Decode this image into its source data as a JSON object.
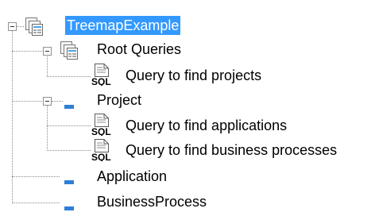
{
  "tree": {
    "nodes": [
      {
        "label": "TreemapExample",
        "icon": "folder-stack-icon",
        "expanded": true,
        "selected": true
      },
      {
        "label": "Root Queries",
        "icon": "folder-stack-icon",
        "expanded": true,
        "selected": false
      },
      {
        "label": "Query to find projects",
        "icon": "sql-query-icon",
        "selected": false
      },
      {
        "label": "Project",
        "icon": "entity-dash-icon",
        "expanded": true,
        "selected": false
      },
      {
        "label": "Query to find applications",
        "icon": "sql-query-icon",
        "selected": false
      },
      {
        "label": "Query to find business processes",
        "icon": "sql-query-icon",
        "selected": false
      },
      {
        "label": "Application",
        "icon": "entity-dash-icon",
        "selected": false
      },
      {
        "label": "BusinessProcess",
        "icon": "entity-dash-icon",
        "selected": false
      }
    ],
    "colors": {
      "selection_background": "#3399ff",
      "selection_text": "#ffffff",
      "entity_icon": "#2f7fd6",
      "connector": "#8a8a8a"
    }
  }
}
